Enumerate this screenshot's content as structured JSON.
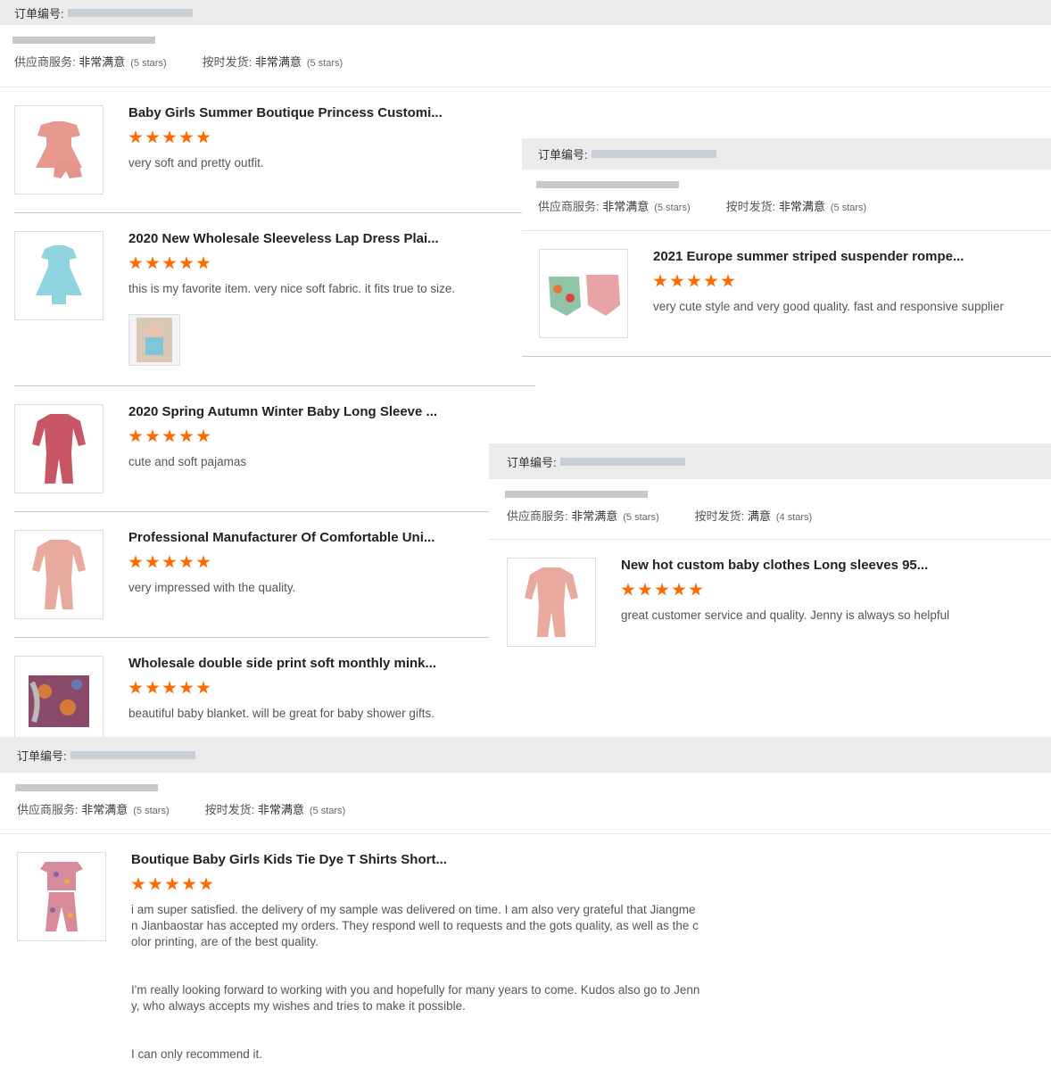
{
  "orders": [
    {
      "order_label": "订单编号:",
      "service_label": "供应商服务:",
      "service_value": "非常满意",
      "service_stars": "(5 stars)",
      "delivery_label": "按时发货:",
      "delivery_value": "非常满意",
      "delivery_stars": "(5 stars)",
      "items": [
        {
          "title": "Baby Girls Summer Boutique Princess Customi...",
          "rating": 5,
          "comment": "very soft and pretty outfit.",
          "image": "pink-dress-shorts"
        },
        {
          "title": "2020 New Wholesale Sleeveless Lap Dress Plai...",
          "rating": 5,
          "comment": "this is my favorite item. very nice soft fabric. it fits true to size.",
          "image": "blue-dress",
          "has_photo": true
        },
        {
          "title": "2020 Spring Autumn Winter Baby Long Sleeve ...",
          "rating": 5,
          "comment": "cute and soft pajamas",
          "image": "red-sleeper"
        },
        {
          "title": "Professional Manufacturer Of Comfortable Uni...",
          "rating": 5,
          "comment": "very impressed with the quality.",
          "image": "pink-sleeper"
        },
        {
          "title": "Wholesale double side print soft monthly mink...",
          "rating": 5,
          "comment": "beautiful baby blanket. will be great for baby shower gifts.",
          "image": "blanket"
        }
      ]
    },
    {
      "order_label": "订单编号:",
      "service_label": "供应商服务:",
      "service_value": "非常满意",
      "service_stars": "(5 stars)",
      "delivery_label": "按时发货:",
      "delivery_value": "非常满意",
      "delivery_stars": "(5 stars)",
      "items": [
        {
          "title": "2021 Europe summer striped suspender rompe...",
          "rating": 5,
          "comment": "very cute style and very good quality. fast and responsive supplier",
          "image": "rompers"
        }
      ]
    },
    {
      "order_label": "订单编号:",
      "service_label": "供应商服务:",
      "service_value": "非常满意",
      "service_stars": "(5 stars)",
      "delivery_label": "按时发货:",
      "delivery_value": "满意",
      "delivery_stars": "(4 stars)",
      "items": [
        {
          "title": "New hot custom baby clothes Long sleeves 95...",
          "rating": 5,
          "comment": "great customer service and quality. Jenny is always so helpful",
          "image": "pink-sleeper"
        }
      ]
    },
    {
      "order_label": "订单编号:",
      "service_label": "供应商服务:",
      "service_value": "非常满意",
      "service_stars": "(5 stars)",
      "delivery_label": "按时发货:",
      "delivery_value": "非常满意",
      "delivery_stars": "(5 stars)",
      "items": [
        {
          "title": "Boutique Baby Girls Kids Tie Dye T Shirts Short...",
          "rating": 5,
          "comment_lines": [
            "i am super satisfied. the delivery of my sample was delivered on time. I am also very grateful that Jiangme",
            "n Jianbaostar has accepted my orders. They respond well to requests and the gots quality, as well as the c",
            "olor printing, are of the best quality.",
            "",
            "",
            "I'm really looking forward to working with you and hopefully for many years to come. Kudos also go to Jenn",
            "y, who always accepts my wishes and tries to make it possible.",
            "",
            "",
            "I can only recommend it."
          ],
          "image": "floral-set"
        }
      ]
    }
  ],
  "colors": {
    "star": "#ff6a00",
    "order_bar": "#ebebeb",
    "redacted": "#c9cfd6"
  }
}
